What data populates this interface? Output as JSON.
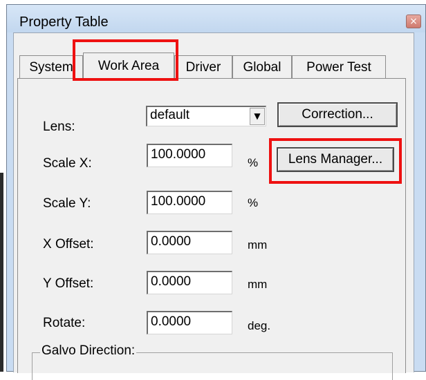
{
  "window": {
    "title": "Property Table",
    "close_glyph": "×"
  },
  "tabs": [
    {
      "label": "System",
      "active": false
    },
    {
      "label": "Work Area",
      "active": true
    },
    {
      "label": "Driver",
      "active": false
    },
    {
      "label": "Global",
      "active": false
    },
    {
      "label": "Power Test",
      "active": false
    }
  ],
  "form": {
    "lens_label": "Lens:",
    "lens_value": "default",
    "lens_arrow": "▼",
    "correction_button": "Correction...",
    "scale_x_label": "Scale X:",
    "scale_x_value": "100.0000",
    "scale_x_unit": "%",
    "lens_manager_button": "Lens Manager...",
    "scale_y_label": "Scale Y:",
    "scale_y_value": "100.0000",
    "scale_y_unit": "%",
    "x_offset_label": "X Offset:",
    "x_offset_value": "0.0000",
    "x_offset_unit": "mm",
    "y_offset_label": "Y Offset:",
    "y_offset_value": "0.0000",
    "y_offset_unit": "mm",
    "rotate_label": "Rotate:",
    "rotate_value": "0.0000",
    "rotate_unit": "deg.",
    "galvo_direction_label": "Galvo Direction:"
  },
  "colors": {
    "highlight": "#ee1111",
    "title_bar": "#c9dcf2",
    "panel": "#f0f0f0"
  }
}
